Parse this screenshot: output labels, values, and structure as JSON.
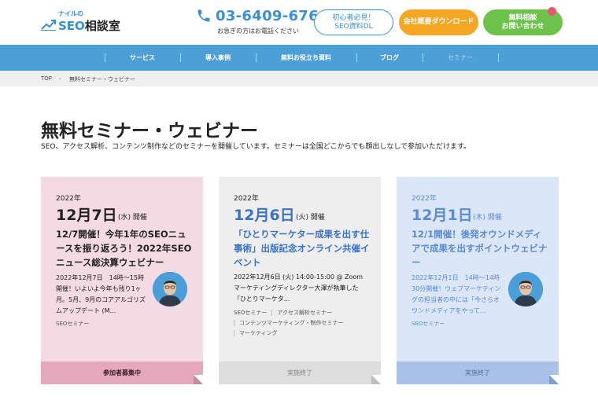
{
  "header": {
    "logo_small": "ナイルの",
    "logo_seo": "SEO",
    "logo_rest": "相談室",
    "phone_number": "03-6409-6766",
    "phone_note": "お急ぎの方はお電話ください",
    "btn_beginner": "初心者必見！\nSEO資料DL",
    "btn_download": "会社概要ダウンロード",
    "btn_consult": "無料相談\nお問い合わせ"
  },
  "nav": {
    "items": [
      "サービス",
      "導入事例",
      "無料お役立ち資料",
      "ブログ",
      "セミナー"
    ]
  },
  "breadcrumb": {
    "top": "TOP",
    "arrow": "›",
    "current": "無料セミナー・ウェビナー"
  },
  "page": {
    "title": "無料セミナー・ウェビナー",
    "description": "SEO、アクセス解析、コンテンツ制作などのセミナーを開催しています。セミナーは全国どこからでも顔出しなしで参加いただけます。"
  },
  "cards": [
    {
      "year": "2022年",
      "date": "12月7日",
      "dow": "(水)",
      "held": "開催",
      "title": "12/7開催！今年1年のSEOニュースを振り返ろう！2022年SEOニュース総決算ウェビナー",
      "text": "2022年12月7日　14時〜15時開催！いよいよ今年も残り1ヶ月。5月、9月のコアアルゴリズムアップデート (M...",
      "tags": [
        "SEOセミナー"
      ],
      "status": "参加者募集中",
      "colors": {
        "body": "#f4dbe3",
        "footer": "#e4a7bc",
        "accent": "#222222",
        "fold": "#c98aa0"
      }
    },
    {
      "year": "2022年",
      "date": "12月6日",
      "dow": "(火)",
      "held": "開催",
      "title": "「ひとりマーケター成果を出す仕事術」出版記念オンライン共催イベント",
      "text": "2022年12月6日 (火) 14:00-15:00 @ Zoom マーケティングディレクター大澤が執筆した「ひとりマーケタ...",
      "tags": [
        "SEOセミナー",
        "アクセス解析セミナー",
        "コンテンツマーケティング・制作セミナー",
        "マーケティング"
      ],
      "status": "実施終了",
      "colors": {
        "body": "#eeeeee",
        "footer": "#dddddd",
        "accent": "#3a72c8",
        "fold": "#bdbdbd"
      }
    },
    {
      "year": "2022年",
      "date": "12月1日",
      "dow": "(木)",
      "held": "開催",
      "title": "12/1開催！後発オウンドメディアで成果を出すポイントウェビナー",
      "text": "2022年12月1日　14時〜14時30分開催！ウェブマーケティングの担当者の中には「今さらオウンドメディアをやって...",
      "tags": [
        "SEOセミナー"
      ],
      "status": "実施終了",
      "colors": {
        "body": "#dbe6f7",
        "footer": "#a9c1e9",
        "accent": "#5b8ad6",
        "fold": "#7f9fd3"
      }
    }
  ]
}
